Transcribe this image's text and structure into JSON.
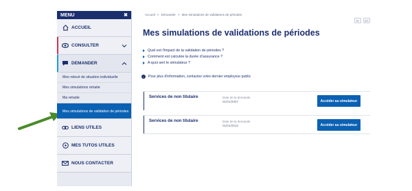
{
  "menu": {
    "header": "MENU",
    "close_symbol": "✖",
    "items": [
      {
        "label": "ACCUEIL",
        "icon": "home-icon"
      },
      {
        "label": "CONSULTER",
        "icon": "eye-icon"
      },
      {
        "label": "DEMANDER",
        "icon": "speech-bubble-icon"
      },
      {
        "label": "LIENS UTILES",
        "icon": "link-icon"
      },
      {
        "label": "MES TUTOS UTILES",
        "icon": "play-icon"
      },
      {
        "label": "NOUS CONTACTER",
        "icon": "envelope-icon"
      }
    ],
    "demander_sub": [
      "Mon relevé de situation individuelle",
      "Mes simulations retraite",
      "Ma retraite",
      "Mes simulations de validation de périodes"
    ],
    "accent_colors": {
      "consulter": "#d6314e",
      "demander": "#1b9be0",
      "active": "#0b61b3",
      "navy": "#1b2e6e"
    }
  },
  "breadcrumb": [
    "Accueil",
    "Demander",
    "Mes simulations de validations de périodes"
  ],
  "breadcrumb_sep": ">",
  "zoom": {
    "minus": "A-",
    "plus": "A+"
  },
  "page": {
    "title": "Mes simulations de validations de périodes",
    "questions": [
      "Quel est l'impact de la validation de périodes ?",
      "Comment est calculée la durée d'assurance ?",
      "A quoi sert le simulateur ?"
    ],
    "info_text": "Pour plus d'information, contactez votre dernier employeur public",
    "info_symbol": "i"
  },
  "simulations": [
    {
      "label": "Services de non titulaire",
      "date_label": "Date de la demande",
      "date": "01/01/2007",
      "button": "Accéder au simulateur"
    },
    {
      "label": "Services de non titulaire",
      "date_label": "Date de la demande",
      "date": "01/01/2013",
      "button": "Accéder au simulateur"
    }
  ]
}
